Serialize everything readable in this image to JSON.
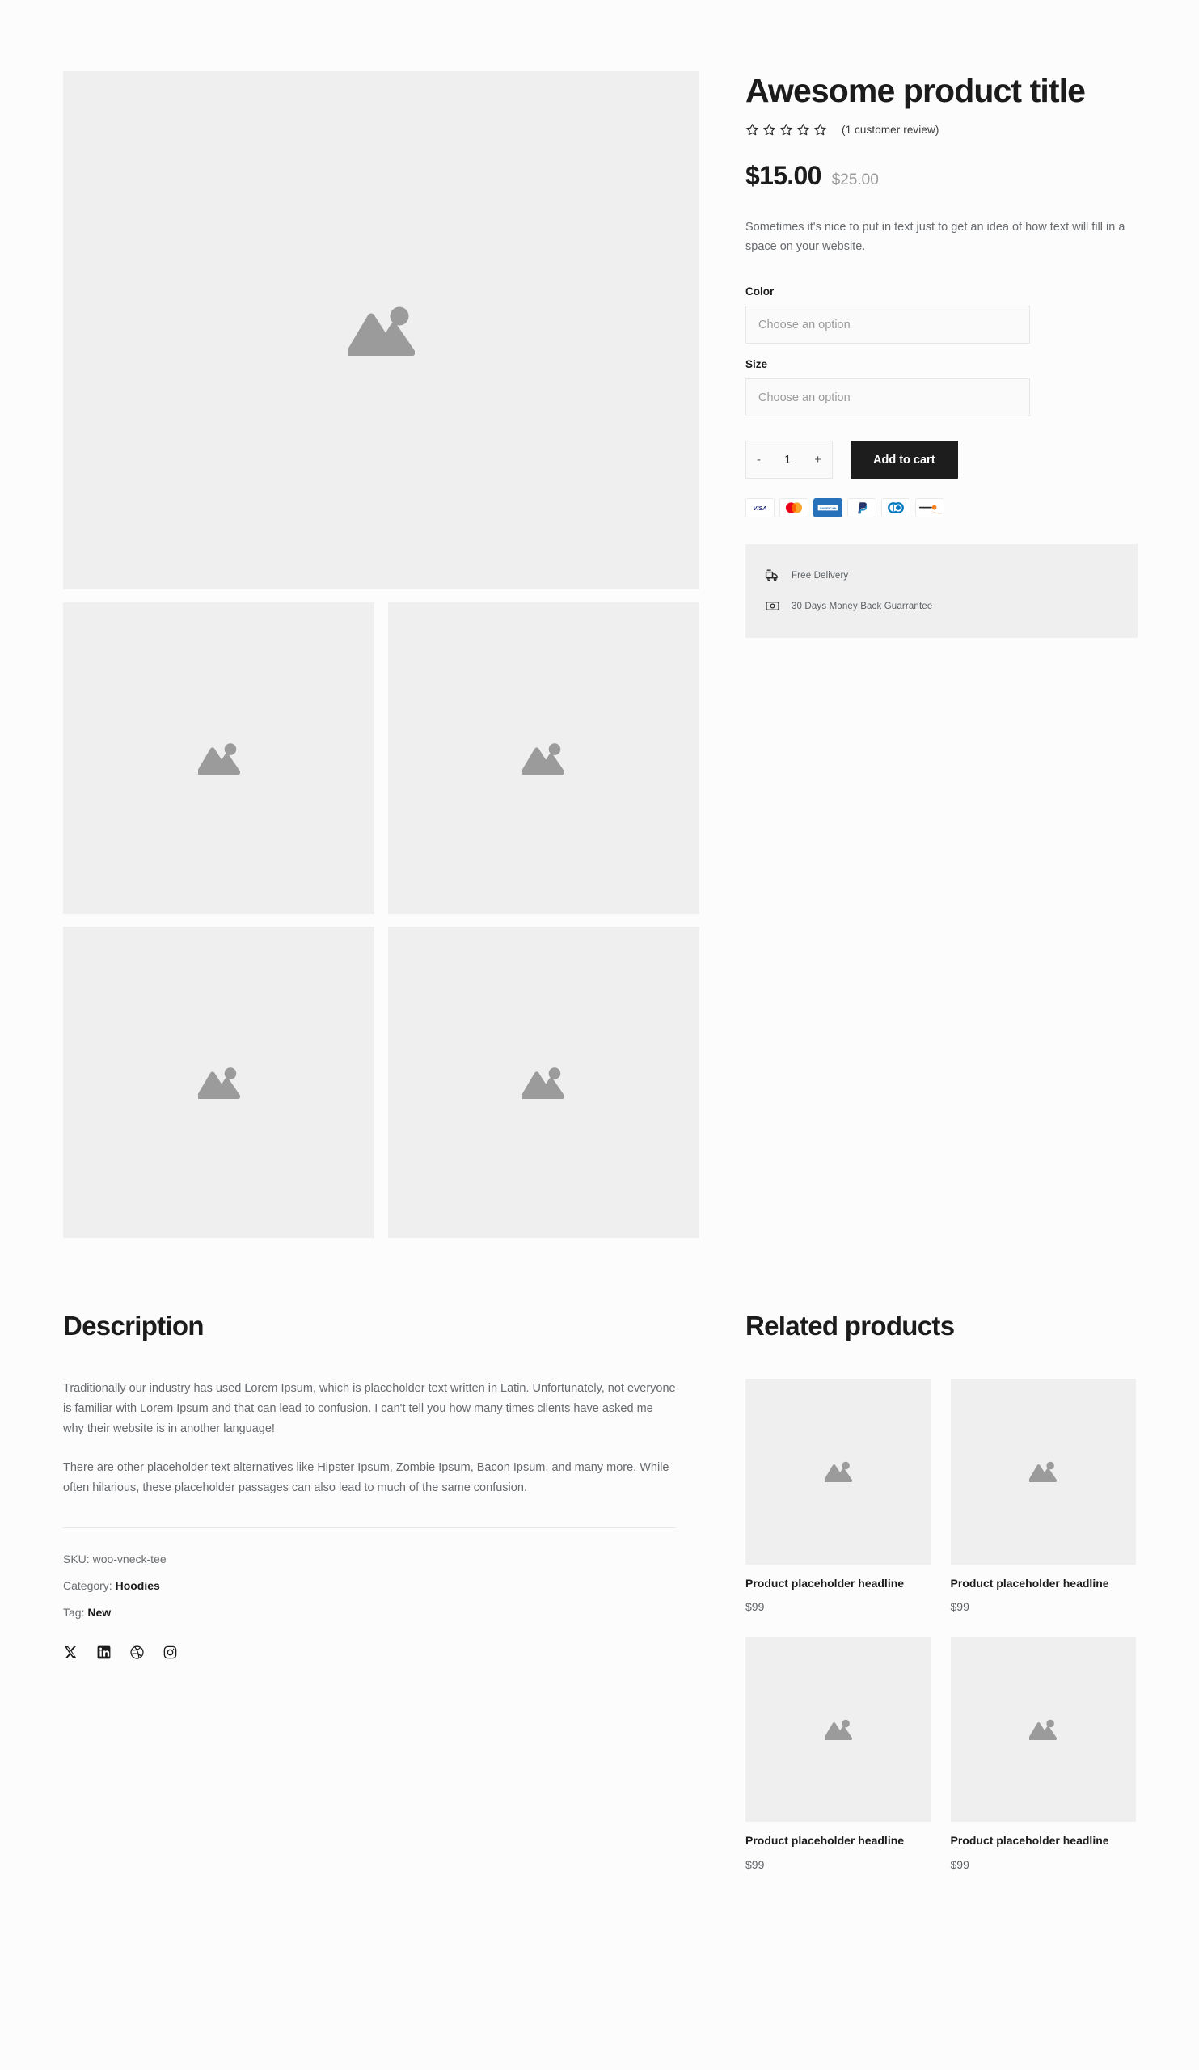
{
  "colors": {
    "page_background": "#fcfcfc",
    "placeholder_fill": "#efefef",
    "placeholder_icon": "#9b9b9b",
    "text_primary": "#1b1b1b",
    "text_muted": "#666a6e",
    "button_dark": "#1d1d1d",
    "sale_price_strike": "#9a9a9a",
    "perks_background": "#efefef"
  },
  "product": {
    "title": "Awesome product title",
    "rating": {
      "stars_total": 5,
      "stars_filled": 0,
      "star_icon": "star-outline-icon",
      "review_link_label": "(1 customer review)"
    },
    "price": {
      "current": "$15.00",
      "original": "$25.00"
    },
    "short_description": "Sometimes it's nice to put in text just to get an idea of how text will fill in a space on your website.",
    "attributes": [
      {
        "label": "Color",
        "selected_value": "",
        "placeholder": "Choose an option"
      },
      {
        "label": "Size",
        "selected_value": "",
        "placeholder": "Choose an option"
      }
    ],
    "quantity": {
      "decrement_label": "-",
      "value": "1",
      "increment_label": "+"
    },
    "add_to_cart_label": "Add to cart",
    "payment_methods": [
      {
        "name": "visa",
        "label": "VISA"
      },
      {
        "name": "mastercard",
        "label": "Mastercard"
      },
      {
        "name": "amex",
        "label": "AMEX"
      },
      {
        "name": "paypal",
        "label": "PayPal"
      },
      {
        "name": "diners-club",
        "label": "Diners Club"
      },
      {
        "name": "discover",
        "label": "Discover"
      }
    ],
    "perks": [
      {
        "icon": "delivery-truck-icon",
        "text": "Free Delivery"
      },
      {
        "icon": "money-back-icon",
        "text": "30 Days Money Back Guarrantee"
      }
    ]
  },
  "gallery": {
    "main_image_alt": "image-placeholder",
    "placeholder_icon": "image-placeholder-icon",
    "thumbnail_count": 4
  },
  "description": {
    "heading": "Description",
    "paragraphs": [
      "Traditionally our industry has used Lorem Ipsum, which is placeholder text written in Latin. Unfortunately, not everyone is familiar with Lorem Ipsum and that can lead to confusion. I can't tell you how many times clients have asked me why their website is in another language!",
      "There are other placeholder text alternatives like Hipster Ipsum, Zombie Ipsum, Bacon Ipsum, and many more. While often hilarious, these placeholder passages can also lead to much of the same confusion."
    ],
    "meta": {
      "sku_label": "SKU:",
      "sku_value": "woo-vneck-tee",
      "category_label": "Category:",
      "category_value": "Hoodies",
      "tag_label": "Tag:",
      "tag_value": "New"
    },
    "socials": [
      {
        "name": "x-twitter-icon",
        "label": "X"
      },
      {
        "name": "linkedin-icon",
        "label": "LinkedIn"
      },
      {
        "name": "dribbble-icon",
        "label": "Dribbble"
      },
      {
        "name": "instagram-icon",
        "label": "Instagram"
      }
    ]
  },
  "related": {
    "heading": "Related products",
    "items": [
      {
        "name": "Product placeholder headline",
        "price": "$99"
      },
      {
        "name": "Product placeholder headline",
        "price": "$99"
      },
      {
        "name": "Product placeholder headline",
        "price": "$99"
      },
      {
        "name": "Product placeholder headline",
        "price": "$99"
      }
    ]
  }
}
